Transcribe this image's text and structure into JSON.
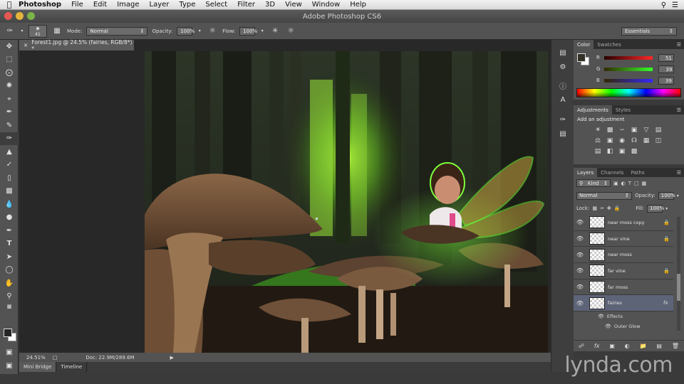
{
  "menubar": {
    "app_name": "Photoshop",
    "items": [
      "File",
      "Edit",
      "Image",
      "Layer",
      "Type",
      "Select",
      "Filter",
      "3D",
      "View",
      "Window",
      "Help"
    ]
  },
  "window": {
    "title": "Adobe Photoshop CS6"
  },
  "options": {
    "brush_size": "41",
    "mode_label": "Mode:",
    "mode_value": "Normal",
    "opacity_label": "Opacity:",
    "opacity_value": "100%",
    "flow_label": "Flow:",
    "flow_value": "100%",
    "workspace": "Essentials"
  },
  "document": {
    "tab_label": "Forest1.jpg @ 24.5% (fairies, RGB/8*) *",
    "zoom": "24.51%",
    "doc_size": "Doc: 22.9M/289.6M"
  },
  "bottom_tabs": [
    "Mini Bridge",
    "Timeline"
  ],
  "color_panel": {
    "tabs": [
      "Color",
      "Swatches"
    ],
    "channels": [
      {
        "label": "R",
        "value": "51"
      },
      {
        "label": "G",
        "value": "39"
      },
      {
        "label": "B",
        "value": "39"
      }
    ],
    "foreground": "#333027",
    "background": "#ffffff"
  },
  "adjustments_panel": {
    "tabs": [
      "Adjustments",
      "Styles"
    ],
    "heading": "Add an adjustment"
  },
  "layers_panel": {
    "tabs": [
      "Layers",
      "Channels",
      "Paths"
    ],
    "kind_label": "Kind",
    "blend_mode": "Normal",
    "opacity_label": "Opacity:",
    "opacity_value": "100%",
    "lock_label": "Lock:",
    "fill_label": "Fill:",
    "fill_value": "100%",
    "layers": [
      {
        "name": "near moss copy",
        "locked": true
      },
      {
        "name": "near vine",
        "locked": true
      },
      {
        "name": "near moss",
        "locked": false
      },
      {
        "name": "far vine",
        "locked": true
      },
      {
        "name": "far moss",
        "locked": false
      },
      {
        "name": "fairies",
        "locked": false,
        "selected": true,
        "fx": "fx"
      }
    ],
    "effects_label": "Effects",
    "effect_item": "Outer Glow"
  },
  "watermark": "lynda.com",
  "colors": {
    "panel": "#535353",
    "selected_layer": "#5e6478",
    "glow": "#7dff3a"
  }
}
